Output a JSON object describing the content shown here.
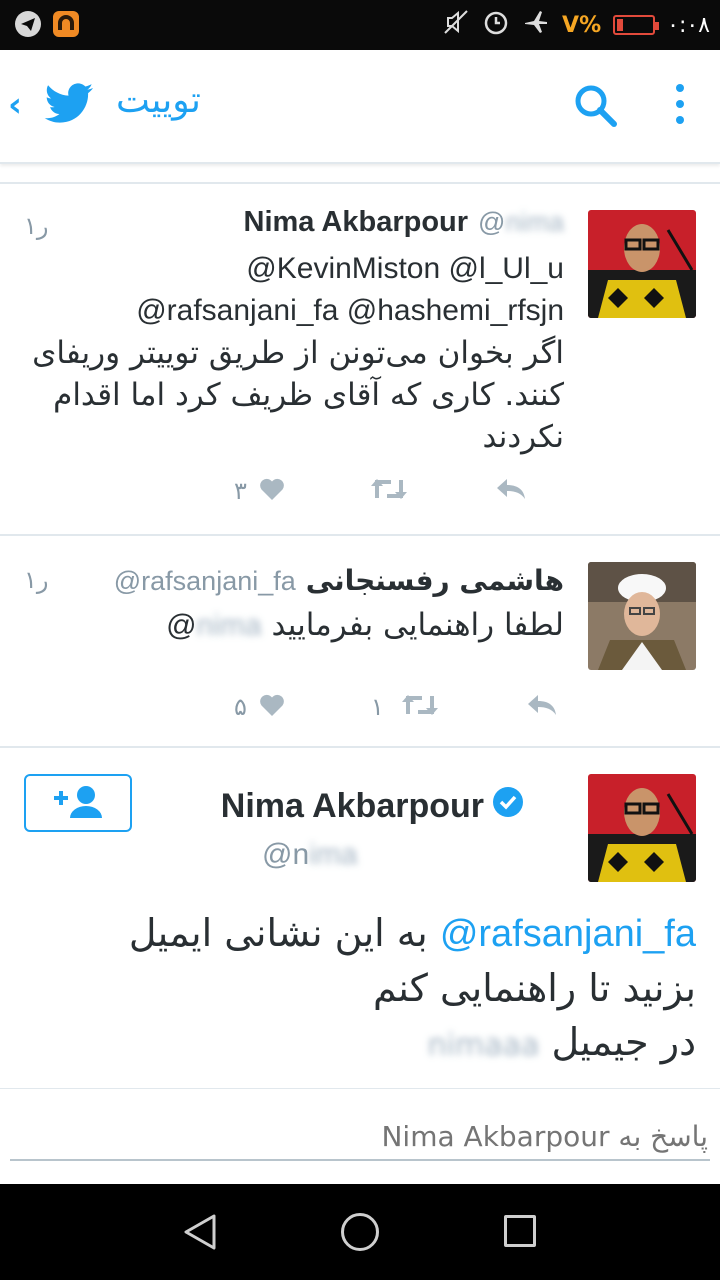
{
  "status_bar": {
    "time": "٠:٠٨",
    "battery_pct": "V%",
    "icons": [
      "telegram-icon",
      "app-badge-icon",
      "mute-icon",
      "alarm-icon",
      "airplane-icon",
      "battery-icon"
    ]
  },
  "header": {
    "title": "توییت",
    "icons": [
      "back-chevron-icon",
      "twitter-bird-icon",
      "search-icon",
      "overflow-menu-icon"
    ],
    "brand_color": "#1da1f2"
  },
  "tweets": [
    {
      "name": "Nima Akbarpour",
      "handle": "@nima",
      "time": "۱ر",
      "mentions_line1": "@KevinMiston @l_Ul_u",
      "mentions_line2": "@rafsanjani_fa @hashemi_rfsjn",
      "text": "اگر بخوان می‌تونن از طریق توییتر وریفای کنند. کاری که آقای ظریف کرد اما اقدام نکردند",
      "likes": "۳",
      "retweets": ""
    },
    {
      "name": "هاشمی رفسنجانی",
      "handle": "@rafsanjani_fa",
      "time": "۱ر",
      "text_mention": "@nima",
      "text": "لطفا راهنمایی بفرمایید",
      "likes": "۵",
      "retweets": "۱"
    }
  ],
  "main_tweet": {
    "name": "Nima Akbarpour",
    "handle_prefix": "@n",
    "handle_blur": "ima",
    "mention": "@rafsanjani_fa",
    "text_line1": "به این نشانی ایمیل",
    "text_line2": "بزنید تا راهنمایی کنم",
    "text_line3": "در جیمیل",
    "text_blur": "nimaaa",
    "verified": true
  },
  "reply": {
    "placeholder": "پاسخ به Nima Akbarpour"
  },
  "nav": {
    "icons": [
      "nav-back-icon",
      "nav-home-icon",
      "nav-recents-icon"
    ]
  }
}
